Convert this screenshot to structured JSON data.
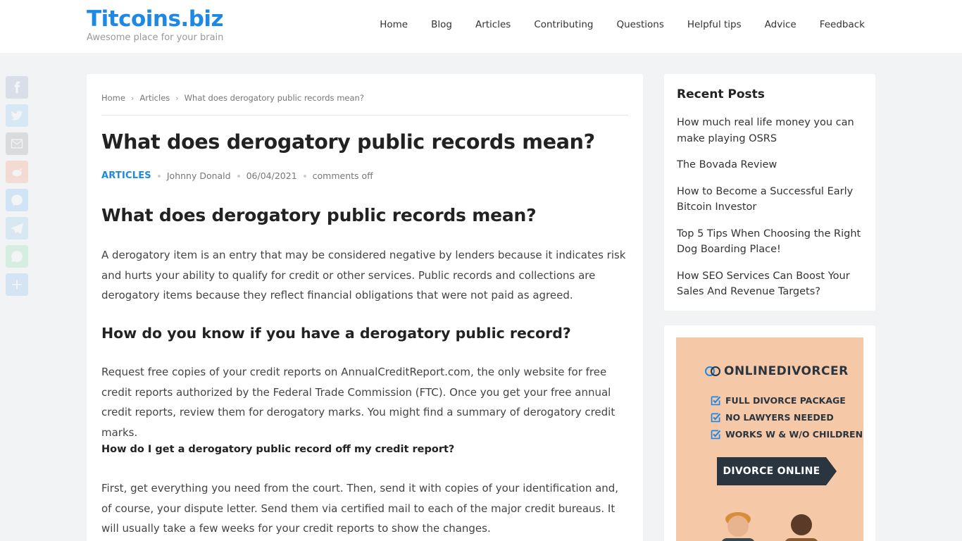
{
  "site": {
    "name": "Titcoins.biz",
    "tagline": "Awesome place for your brain"
  },
  "nav": [
    "Home",
    "Blog",
    "Articles",
    "Contributing",
    "Questions",
    "Helpful tips",
    "Advice",
    "Feedback"
  ],
  "share_icons": [
    "facebook-icon",
    "twitter-icon",
    "email-icon",
    "reddit-icon",
    "messenger-icon",
    "telegram-icon",
    "whatsapp-icon",
    "share-icon"
  ],
  "breadcrumb": [
    "Home",
    "Articles",
    "What does derogatory public records mean?"
  ],
  "article": {
    "title": "What does derogatory public records mean?",
    "category": "ARTICLES",
    "author": "Johnny Donald",
    "date": "06/04/2021",
    "comments": "comments off",
    "heading1": "What does derogatory public records mean?",
    "para1": "A derogatory item is an entry that may be considered negative by lenders because it indicates risk and hurts your ability to qualify for credit or other services. Public records and collections are derogatory items because they reflect financial obligations that were not paid as agreed.",
    "heading2": "How do you know if you have a derogatory public record?",
    "para2": "Request free copies of your credit reports on AnnualCreditReport.com, the only website for free credit reports authorized by the Federal Trade Commission (FTC). Once you get your free annual credit reports, review them for derogatory marks. You might find a summary of derogatory credit marks.",
    "heading3": "How do I get a derogatory public record off my credit report?",
    "para3": "First, get everything you need from the court. Then, send it with copies of your identification and, of course, your dispute letter. Send them via certified mail to each of the major credit bureaus. It will usually take a few weeks for your credit reports to show the changes."
  },
  "sidebar": {
    "recent_title": "Recent Posts",
    "recent_posts": [
      "How much real life money you can make playing OSRS",
      "The Bovada Review",
      "How to Become a Successful Early Bitcoin Investor",
      "Top 5 Tips When Choosing the Right Dog Boarding Place!",
      "How SEO Services Can Boost Your Sales And Revenue Targets?"
    ]
  },
  "ad": {
    "brand": "ONLINEDIVORCER",
    "features": [
      "FULL DIVORCE PACKAGE",
      "NO LAWYERS NEEDED",
      "WORKS W & W/O CHILDREN"
    ],
    "cta": "DIVORCE ONLINE",
    "colors": {
      "background": "#f5c8a8",
      "dark": "#2a3540",
      "check": "#1e88e5"
    }
  },
  "colors": {
    "accent": "#1e88e5",
    "page_bg": "#f2f3f5"
  }
}
